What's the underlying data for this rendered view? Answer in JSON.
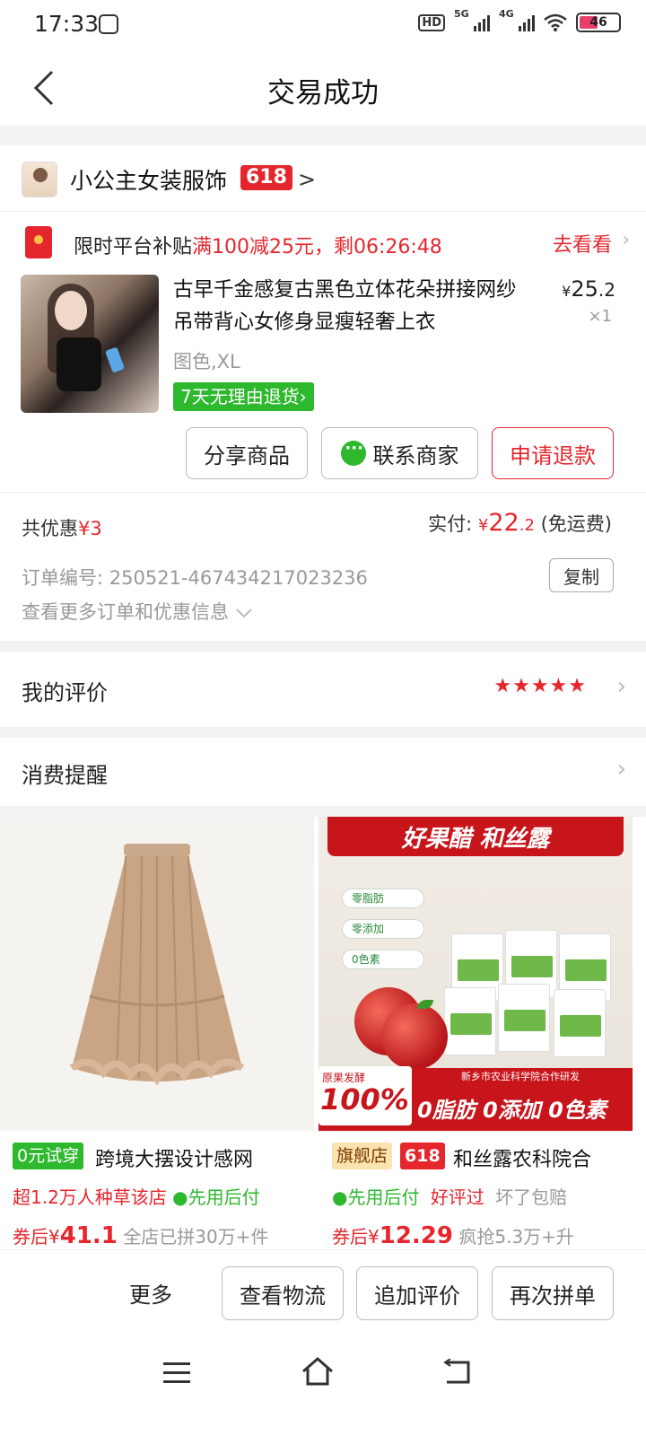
{
  "status_bar": {
    "time": "17:33",
    "hd": "HD",
    "net1": "5G",
    "net2": "4G",
    "battery": "46"
  },
  "nav": {
    "title": "交易成功"
  },
  "shop": {
    "name": "小公主女装服饰",
    "badge": "618"
  },
  "subsidy": {
    "prefix": "限时平台补贴",
    "offer": "满100减25元，剩06:26:48",
    "link": "去看看"
  },
  "product": {
    "title": "古早千金感复古黑色立体花朵拼接网纱吊带背心女修身显瘦轻奢上衣",
    "price_symbol": "¥",
    "price_int": "25",
    "price_dec": ".2",
    "quantity": "×1",
    "sku": "图色,XL",
    "return_policy": "7天无理由退货"
  },
  "actions": {
    "share": "分享商品",
    "contact": "联系商家",
    "refund": "申请退款"
  },
  "summary": {
    "discount_label": "共优惠",
    "discount_value": "¥3",
    "paid_label": "实付: ",
    "paid_symbol": "¥",
    "paid_int": "22",
    "paid_dec": ".2",
    "shipping": "(免运费)"
  },
  "order": {
    "number": "订单编号: 250521-467434217023236",
    "copy": "复制",
    "more": "查看更多订单和优惠信息"
  },
  "review": {
    "label": "我的评价",
    "stars": "★★★★★",
    "rating": 5
  },
  "reminder": {
    "label": "消费提醒"
  },
  "recommendations": [
    {
      "badge": "0元试穿",
      "name": "跨境大摆设计感网",
      "social": "超1.2万人种草该店",
      "pay_later": "先用后付",
      "price_prefix": "券后",
      "price_symbol": "¥",
      "price": "41.1",
      "sales": "全店已拼30万+件"
    },
    {
      "badge": "旗舰店",
      "badge2": "618",
      "name": "和丝露农科院合",
      "pay_later": "先用后付",
      "tag2": "好评过",
      "tag3": "坏了包赔",
      "price_prefix": "券后",
      "price_symbol": "¥",
      "price": "12.29",
      "sales": "疯抢5.3万+升",
      "image": {
        "banner": "好果醋 和丝露",
        "tags": [
          "零脂肪",
          "零添加",
          "0色素"
        ],
        "strip": "新乡市农业科学院合作研发",
        "sub": "原果发酵",
        "percent": "100%",
        "claims": "0脂肪 0添加 0色素"
      }
    }
  ],
  "bottom_bar": {
    "more": "更多",
    "logistics": "查看物流",
    "add_review": "追加评价",
    "reorder": "再次拼单"
  }
}
